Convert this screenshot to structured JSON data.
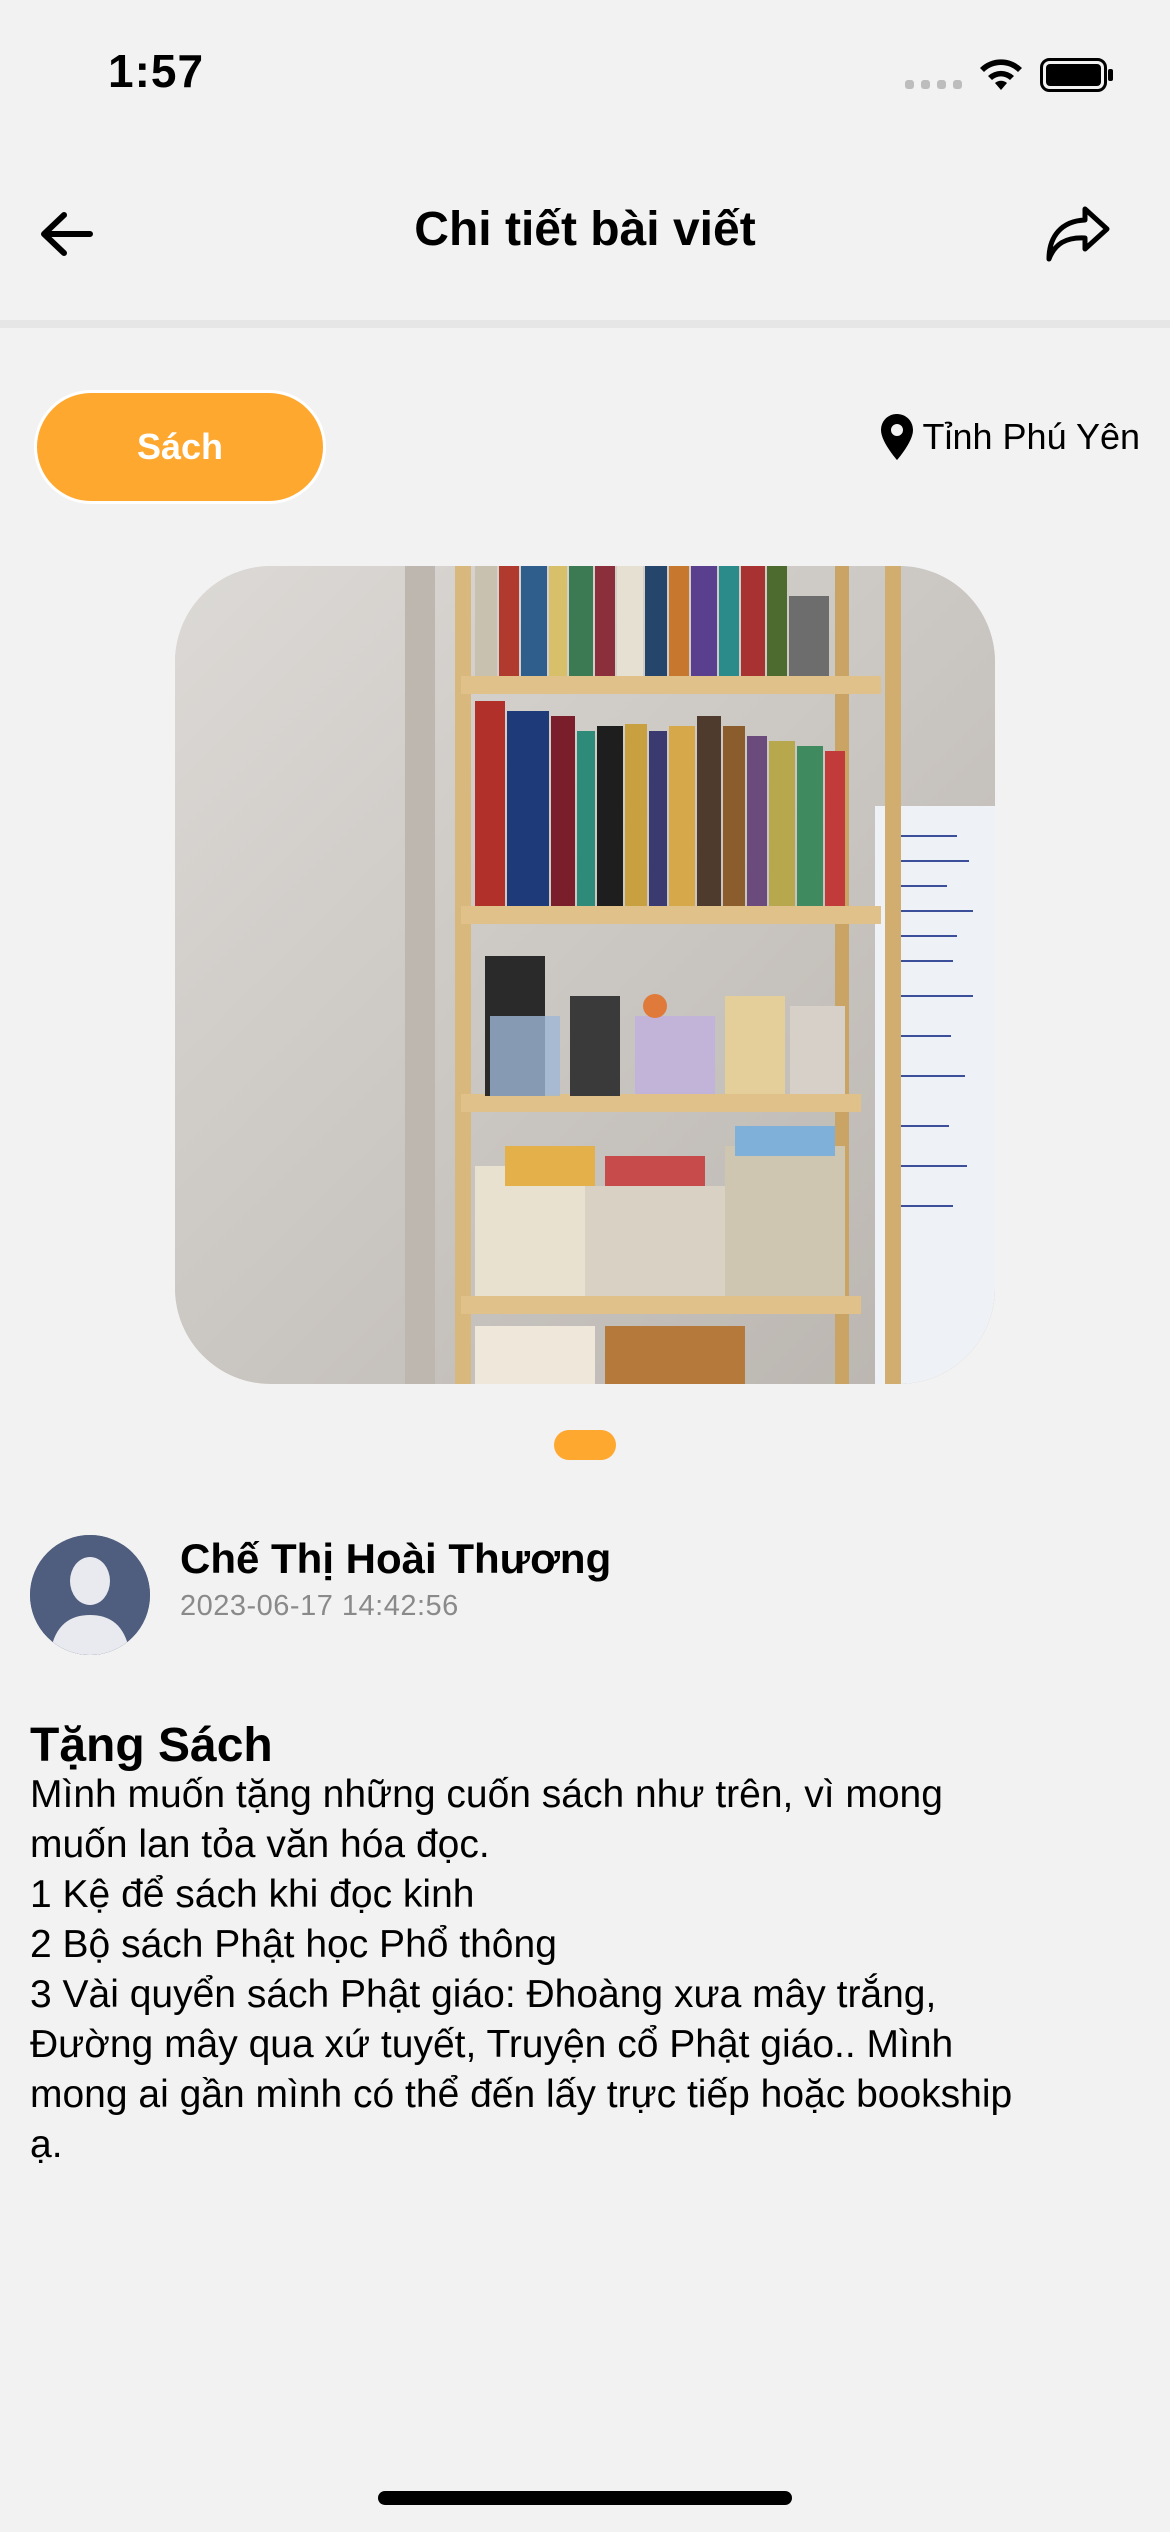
{
  "status_bar": {
    "time": "1:57"
  },
  "header": {
    "title": "Chi tiết bài viết"
  },
  "post": {
    "category": "Sách",
    "location": "Tỉnh Phú Yên",
    "image_count": 1,
    "current_image": 1,
    "author": {
      "name": "Chế Thị Hoài Thương",
      "timestamp": "2023-06-17 14:42:56"
    },
    "title": "Tặng Sách",
    "body_lines": [
      "Mình muốn tặng những cuốn sách như trên, vì mong",
      "muốn lan tỏa văn hóa đọc.",
      "1 Kệ để sách khi đọc kinh",
      "2 Bộ sách Phật học Phổ thông",
      "3 Vài quyển sách Phật giáo: Đhoàng xưa mây trắng,",
      "Đường mây qua xứ tuyết, Truyện cổ Phật giáo.. Mình",
      "mong ai gần mình có thể đến lấy trực tiếp hoặc bookship",
      "ạ."
    ]
  },
  "icons": {
    "back": "arrow-left-icon",
    "share": "share-forward-icon",
    "location": "map-pin-icon",
    "avatar": "default-user-avatar"
  },
  "colors": {
    "accent": "#fea82f",
    "avatar_bg": "#4f5d7e",
    "timestamp": "#8a8a8a",
    "background": "#f2f2f2"
  }
}
